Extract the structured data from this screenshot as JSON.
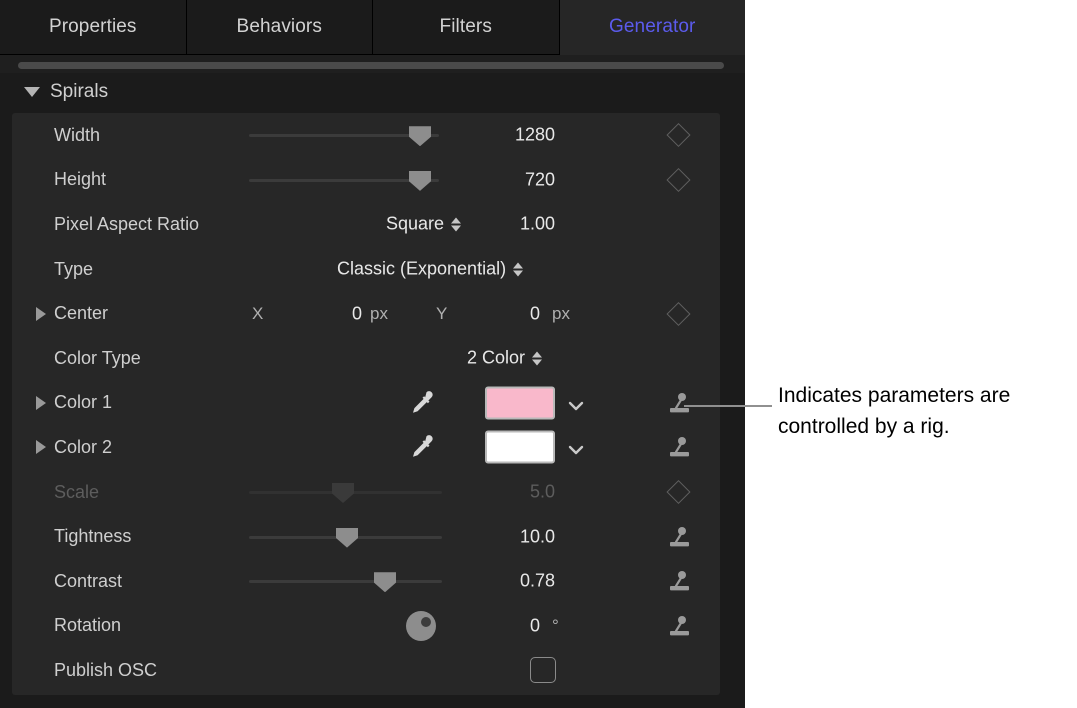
{
  "tabs": [
    {
      "label": "Properties",
      "active": false
    },
    {
      "label": "Behaviors",
      "active": false
    },
    {
      "label": "Filters",
      "active": false
    },
    {
      "label": "Generator",
      "active": true
    }
  ],
  "group": {
    "title": "Spirals"
  },
  "colors": {
    "accent": "#5b5bec",
    "color1_swatch": "#f9b8cb",
    "color2_swatch": "#ffffff",
    "panel_bg": "#1b1b1b",
    "list_bg": "#272727"
  },
  "rows": {
    "width": {
      "label": "Width",
      "value": "1280"
    },
    "height": {
      "label": "Height",
      "value": "720"
    },
    "par": {
      "label": "Pixel Aspect Ratio",
      "option": "Square",
      "value": "1.00"
    },
    "type": {
      "label": "Type",
      "option": "Classic (Exponential)"
    },
    "center": {
      "label": "Center",
      "x_axis": "X",
      "x_value": "0",
      "x_unit": "px",
      "y_axis": "Y",
      "y_value": "0",
      "y_unit": "px"
    },
    "colortype": {
      "label": "Color Type",
      "option": "2 Color"
    },
    "color1": {
      "label": "Color 1"
    },
    "color2": {
      "label": "Color 2"
    },
    "scale": {
      "label": "Scale",
      "value": "5.0"
    },
    "tightness": {
      "label": "Tightness",
      "value": "10.0"
    },
    "contrast": {
      "label": "Contrast",
      "value": "0.78"
    },
    "rotation": {
      "label": "Rotation",
      "value": "0",
      "unit": "°"
    },
    "publish": {
      "label": "Publish OSC"
    }
  },
  "callout": {
    "text": "Indicates parameters are controlled by a rig."
  }
}
